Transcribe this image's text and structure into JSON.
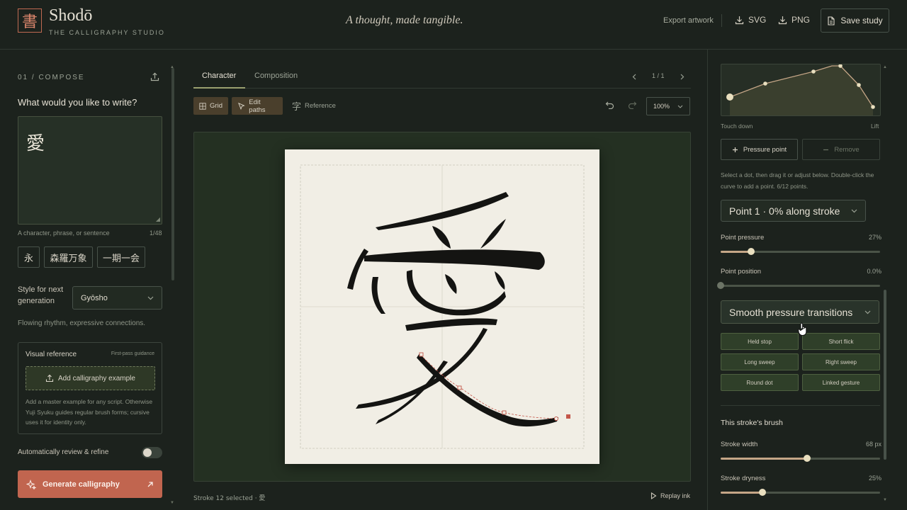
{
  "header": {
    "logo_glyph": "書",
    "brand": "Shodō",
    "brand_sub": "THE CALLIGRAPHY STUDIO",
    "tagline": "A thought, made tangible.",
    "export_label": "Export artwork",
    "svg_label": "SVG",
    "png_label": "PNG",
    "save_label": "Save study",
    "download_icon": "download-icon",
    "save_icon": "document-icon"
  },
  "left": {
    "section": "01 / COMPOSE",
    "question": "What would you like to write?",
    "text_value": "愛",
    "hint": "A character, phrase, or sentence",
    "count": "1/48",
    "chips": [
      "永",
      "森羅万象",
      "一期一会"
    ],
    "style_label": "Style for next generation",
    "style_value": "Gyōsho",
    "style_desc": "Flowing rhythm, expressive connections.",
    "visref_title": "Visual reference",
    "visref_tag": "First-pass guidance",
    "add_example": "Add calligraphy example",
    "visref_note": "Add a master example for any script. Otherwise Yuji Syuku guides regular brush forms; cursive uses it for identity only.",
    "auto_review": "Automatically review & refine",
    "auto_review_on": false,
    "generate": "Generate calligraphy"
  },
  "center": {
    "tabs": [
      "Character",
      "Composition"
    ],
    "active_tab": "Character",
    "pager": "1 / 1",
    "tools": {
      "grid": "Grid",
      "edit": "Edit paths",
      "reference": "Reference",
      "reference_glyph": "字"
    },
    "zoom": "100%",
    "status": "Stroke 12 selected · 愛",
    "replay": "Replay ink"
  },
  "right": {
    "axis_left": "Touch down",
    "axis_right": "Lift",
    "add_point": "Pressure point",
    "remove": "Remove",
    "help": "Select a dot, then drag it or adjust below. Double-click the curve to add a point. 6/12 points.",
    "point_select": "Point 1 · 0% along stroke",
    "point_pressure_label": "Point pressure",
    "point_pressure_value": "27%",
    "point_pressure_frac": 0.19,
    "point_position_label": "Point position",
    "point_position_value": "0.0%",
    "point_position_frac": 0.0,
    "smooth_select": "Smooth pressure transitions",
    "presets": [
      "Held stop",
      "Short flick",
      "Long sweep",
      "Right sweep",
      "Round dot",
      "Linked gesture"
    ],
    "brush_title": "This stroke's brush",
    "width_label": "Stroke width",
    "width_value": "68 px",
    "width_frac": 0.54,
    "dryness_label": "Stroke dryness",
    "dryness_value": "25%",
    "dryness_frac": 0.26
  },
  "colors": {
    "accent": "#c1654f",
    "background": "#1c221d",
    "paper": "#f1eee5",
    "ink": "#141412",
    "slider": "#c5a687"
  }
}
